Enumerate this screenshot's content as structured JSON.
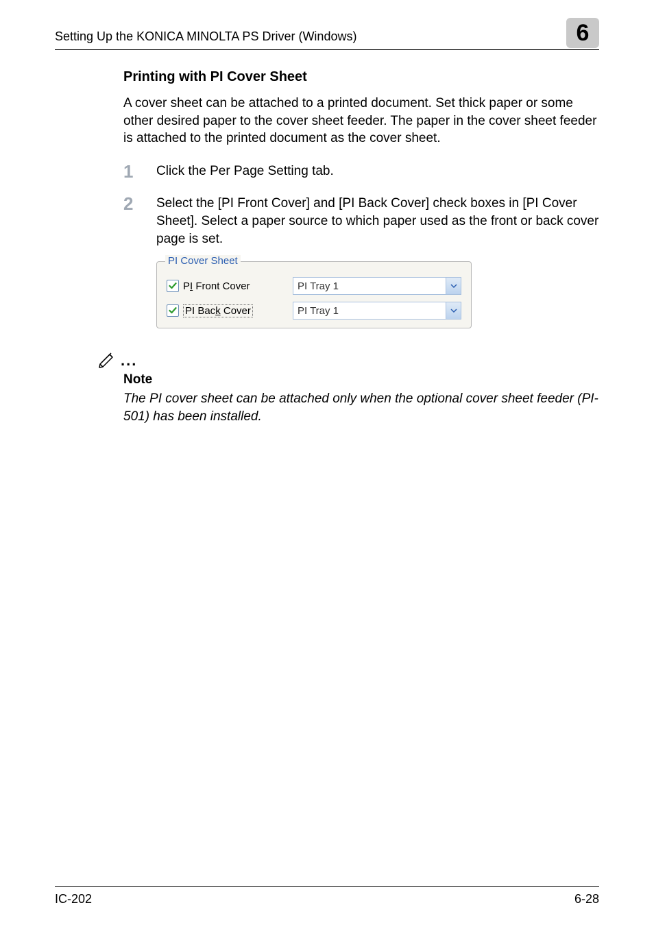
{
  "header": {
    "title": "Setting Up the KONICA MINOLTA PS Driver (Windows)",
    "chapter": "6"
  },
  "section_title": "Printing with PI Cover Sheet",
  "intro": "A cover sheet can be attached to a printed document. Set thick paper or some other desired paper to the cover sheet feeder. The paper in the cover sheet feeder is attached to the printed document as the cover sheet.",
  "steps": [
    {
      "num": "1",
      "text": "Click the Per Page Setting tab."
    },
    {
      "num": "2",
      "text": "Select the [PI Front Cover] and [PI Back Cover] check boxes in [PI Cover Sheet]. Select a paper source to which paper used as the front or back cover page is set."
    }
  ],
  "panel": {
    "legend": "PI Cover Sheet",
    "rows": [
      {
        "label_pre": "P",
        "label_ul": "I",
        "label_post": " Front Cover",
        "select": "PI Tray 1"
      },
      {
        "label_pre": "PI Bac",
        "label_ul": "k",
        "label_post": " Cover",
        "select": "PI Tray 1"
      }
    ]
  },
  "note": {
    "label": "Note",
    "body": "The PI cover sheet can be attached only when the optional cover sheet feeder (PI-501) has been installed."
  },
  "footer": {
    "left": "IC-202",
    "right": "6-28"
  }
}
